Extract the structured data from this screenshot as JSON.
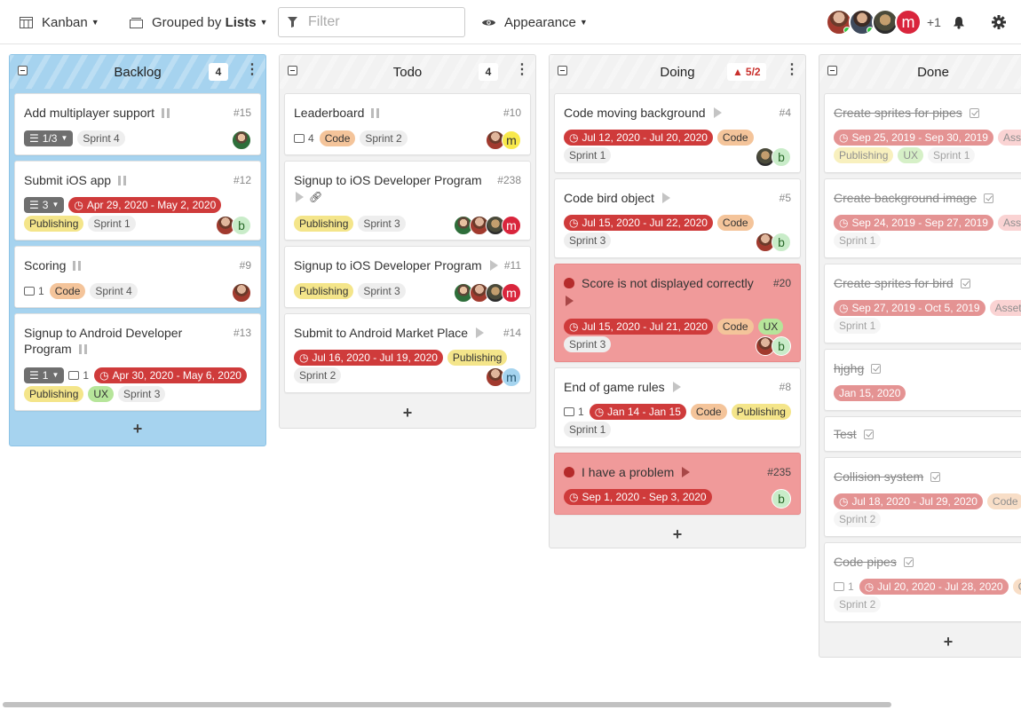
{
  "toolbar": {
    "view_label": "Kanban",
    "group_prefix": "Grouped by",
    "group_value": "Lists",
    "filter_placeholder": "Filter",
    "appearance_label": "Appearance",
    "more_users": "+1"
  },
  "columns": [
    {
      "title": "Backlog",
      "count": "4",
      "cards": [
        {
          "title": "Add multiplayer support",
          "num": "#15",
          "labels": [
            "1/3",
            "Sprint 4"
          ]
        },
        {
          "title": "Submit iOS app",
          "num": "#12",
          "checklist": "3",
          "date": "Apr 29, 2020 - May 2, 2020",
          "labels": [
            "Publishing",
            "Sprint 1"
          ],
          "avatar_letter": "b"
        },
        {
          "title": "Scoring",
          "num": "#9",
          "comments": "1",
          "labels": [
            "Code",
            "Sprint 4"
          ]
        },
        {
          "title": "Signup to Android Developer Program",
          "num": "#13",
          "checklist": "1",
          "comments": "1",
          "date": "Apr 30, 2020 - May 6, 2020",
          "labels": [
            "Publishing",
            "UX",
            "Sprint 3"
          ]
        }
      ]
    },
    {
      "title": "Todo",
      "count": "4",
      "cards": [
        {
          "title": "Leaderboard",
          "num": "#10",
          "comments": "4",
          "labels": [
            "Code",
            "Sprint 2"
          ],
          "avatar_letter": "m"
        },
        {
          "title": "Signup to iOS Developer Program",
          "num": "#238",
          "labels": [
            "Publishing",
            "Sprint 3"
          ],
          "avatar_letter": "m"
        },
        {
          "title": "Signup to iOS Developer Program",
          "num": "#11",
          "labels": [
            "Publishing",
            "Sprint 3"
          ],
          "avatar_letter": "m"
        },
        {
          "title": "Submit to Android Market Place",
          "num": "#14",
          "date": "Jul 16, 2020 - Jul 19, 2020",
          "labels": [
            "Publishing",
            "Sprint 2"
          ],
          "avatar_letter": "m"
        }
      ]
    },
    {
      "title": "Doing",
      "count": "5/2",
      "cards": [
        {
          "title": "Code moving background",
          "num": "#4",
          "date": "Jul 12, 2020 - Jul 20, 2020",
          "labels": [
            "Code",
            "Sprint 1"
          ],
          "avatar_letter": "b"
        },
        {
          "title": "Code bird object",
          "num": "#5",
          "date": "Jul 15, 2020 - Jul 22, 2020",
          "labels": [
            "Code",
            "Sprint 3"
          ],
          "avatar_letter": "b"
        },
        {
          "title": "Score is not displayed correctly",
          "num": "#20",
          "date": "Jul 15, 2020 - Jul 21, 2020",
          "labels": [
            "Code",
            "UX",
            "Sprint 3"
          ],
          "avatar_letter": "b"
        },
        {
          "title": "End of game rules",
          "num": "#8",
          "comments": "1",
          "date": "Jan 14 - Jan 15",
          "labels": [
            "Code",
            "Publishing",
            "Sprint 1"
          ]
        },
        {
          "title": "I have a problem",
          "num": "#235",
          "date": "Sep 1, 2020 - Sep 3, 2020",
          "avatar_letter": "b"
        }
      ]
    },
    {
      "title": "Done",
      "cards": [
        {
          "title": "Create sprites for pipes",
          "date": "Sep 25, 2019 - Sep 30, 2019",
          "labels": [
            "Asset",
            "Publishing",
            "UX",
            "Sprint 1"
          ]
        },
        {
          "title": "Create background image",
          "date": "Sep 24, 2019 - Sep 27, 2019",
          "labels": [
            "Asset",
            "Sprint 1"
          ]
        },
        {
          "title": "Create sprites for bird",
          "date": "Sep 27, 2019 - Oct 5, 2019",
          "labels": [
            "Assets",
            "Sprint 1"
          ]
        },
        {
          "title": "hjghg",
          "date": "Jan 15, 2020"
        },
        {
          "title": "Test"
        },
        {
          "title": "Collision system",
          "date": "Jul 18, 2020 - Jul 29, 2020",
          "labels": [
            "Code",
            "Sprint 2"
          ]
        },
        {
          "title": "Code pipes",
          "comments": "1",
          "date": "Jul 20, 2020 - Jul 28, 2020",
          "labels": [
            "Co",
            "Sprint 2"
          ]
        }
      ]
    }
  ],
  "add_symbol": "+",
  "colors": {
    "backlog_bg": "#a6d3ef",
    "bug_card": "#f09a9a",
    "date_label": "#cf3b3b",
    "code_label": "#f4c49a",
    "publishing_label": "#f4e58a",
    "ux_label": "#b6e59a"
  },
  "icons": [
    "kanban-icon",
    "layers-icon",
    "filter-icon",
    "eye-icon",
    "bell-icon",
    "gear-icon",
    "bug-icon",
    "comment-icon",
    "clock-icon",
    "link-icon",
    "warning-icon",
    "checklist-icon"
  ]
}
